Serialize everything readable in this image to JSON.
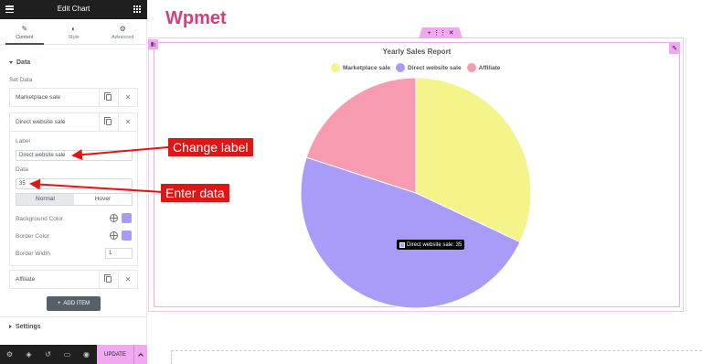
{
  "editor": {
    "title": "Edit Chart",
    "tabs": [
      {
        "label": "Content",
        "icon": "pencil-icon"
      },
      {
        "label": "Style",
        "icon": "half-circle-icon"
      },
      {
        "label": "Advanced",
        "icon": "gear-icon"
      }
    ],
    "data_section": "Data",
    "set_data_label": "Set Data",
    "items": [
      "Marketplace sale",
      "Direct website sale",
      "Affiliate"
    ],
    "expanded": {
      "label_field": "Label",
      "label_value": "Direct website sale",
      "data_field": "Data",
      "data_value": "35",
      "toggle": [
        "Normal",
        "Hover"
      ],
      "bg_color_label": "Background Color",
      "border_color_label": "Border Color",
      "border_width_label": "Border Width",
      "border_width_value": "1",
      "color": "#a99bf8"
    },
    "add_item": "ADD ITEM",
    "settings_section": "Settings",
    "update_label": "UPDATE"
  },
  "canvas": {
    "brand": "Wpmet",
    "brand_color": "#d1407d"
  },
  "chart_data": {
    "type": "pie",
    "title": "Yearly Sales Report",
    "series": [
      {
        "name": "Marketplace sale",
        "value": 32,
        "color": "#f5f48a"
      },
      {
        "name": "Direct website sale",
        "value": 48,
        "color": "#a99bf8"
      },
      {
        "name": "Affiliate",
        "value": 20,
        "color": "#f79bb0"
      }
    ],
    "legend": "top",
    "tooltip": "Direct website sale: 35"
  },
  "annotations": {
    "change_label": "Change label",
    "enter_data": "Enter data"
  }
}
